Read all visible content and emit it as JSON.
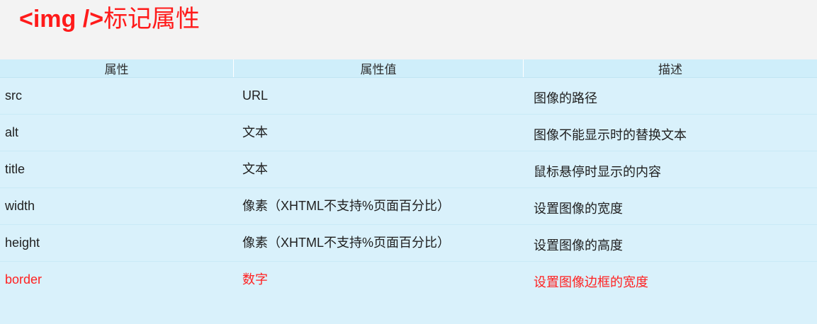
{
  "title": {
    "tag": "<img />",
    "text": "标记属性"
  },
  "table": {
    "headers": [
      "属性",
      "属性值",
      "描述"
    ],
    "rows": [
      {
        "attribute": "src",
        "value": "URL",
        "description": "图像的路径"
      },
      {
        "attribute": "alt",
        "value": "文本",
        "description": "图像不能显示时的替换文本"
      },
      {
        "attribute": "title",
        "value": "文本",
        "description": "鼠标悬停时显示的内容"
      },
      {
        "attribute": "width",
        "value": "像素（XHTML不支持%页面百分比）",
        "description": "设置图像的宽度"
      },
      {
        "attribute": "height",
        "value": "像素（XHTML不支持%页面百分比）",
        "description": "设置图像的高度"
      },
      {
        "attribute": "border",
        "value": "数字",
        "description": "设置图像边框的宽度"
      }
    ]
  },
  "colors": {
    "title": "#ff1a1a",
    "table_background": "#d9f1fb",
    "highlight_text": "#ff2121"
  }
}
